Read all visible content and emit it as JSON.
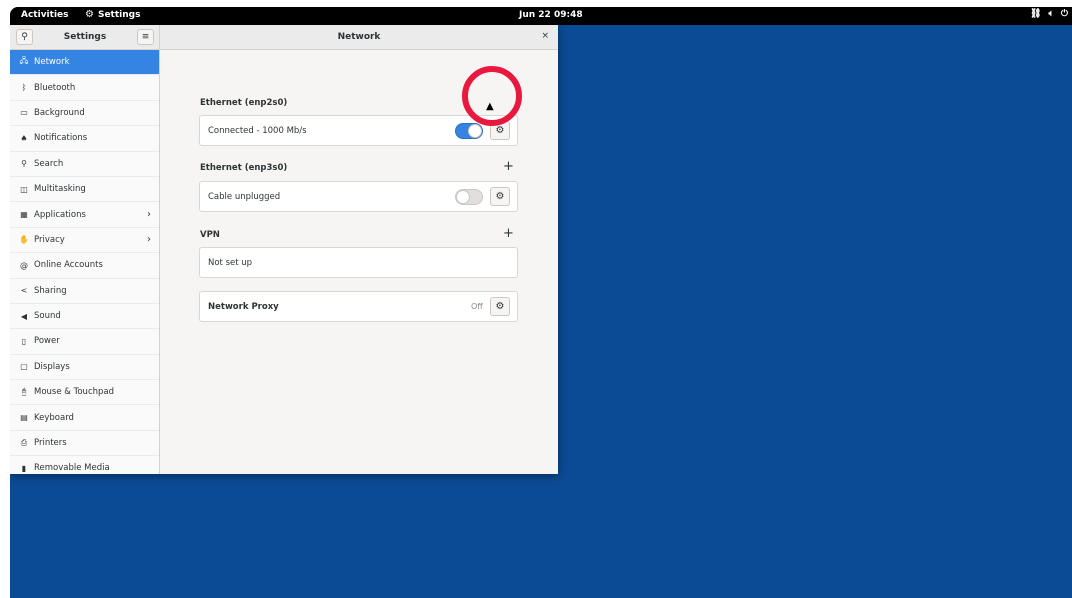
{
  "topbar": {
    "activities": "Activities",
    "app_name": "Settings",
    "clock": "Jun 22  09:48",
    "tray_icons": [
      "network-icon",
      "volume-icon",
      "power-icon"
    ]
  },
  "window": {
    "sidebar_title": "Settings",
    "main_title": "Network",
    "close_glyph": "×"
  },
  "sidebar": {
    "items": [
      {
        "label": "Network",
        "icon": "network-icon",
        "active": true
      },
      {
        "label": "Bluetooth",
        "icon": "bluetooth-icon"
      },
      {
        "label": "Background",
        "icon": "background-icon"
      },
      {
        "label": "Notifications",
        "icon": "bell-icon"
      },
      {
        "label": "Search",
        "icon": "search-icon"
      },
      {
        "label": "Multitasking",
        "icon": "multitasking-icon"
      },
      {
        "label": "Applications",
        "icon": "applications-icon",
        "chevron": true
      },
      {
        "label": "Privacy",
        "icon": "privacy-icon",
        "chevron": true
      },
      {
        "label": "Online Accounts",
        "icon": "at-icon"
      },
      {
        "label": "Sharing",
        "icon": "share-icon"
      },
      {
        "label": "Sound",
        "icon": "speaker-icon"
      },
      {
        "label": "Power",
        "icon": "battery-icon"
      },
      {
        "label": "Displays",
        "icon": "display-icon"
      },
      {
        "label": "Mouse & Touchpad",
        "icon": "mouse-icon"
      },
      {
        "label": "Keyboard",
        "icon": "keyboard-icon"
      },
      {
        "label": "Printers",
        "icon": "printer-icon"
      },
      {
        "label": "Removable Media",
        "icon": "usb-icon"
      }
    ]
  },
  "network": {
    "ethernet1": {
      "label": "Ethernet (enp2s0)",
      "status": "Connected - 1000 Mb/s",
      "enabled": true
    },
    "ethernet2": {
      "label": "Ethernet (enp3s0)",
      "status": "Cable unplugged",
      "enabled": false,
      "add": "+"
    },
    "vpn": {
      "label": "VPN",
      "status": "Not set up",
      "add": "+"
    },
    "proxy": {
      "label": "Network Proxy",
      "state": "Off"
    }
  },
  "colors": {
    "accent": "#3584e4",
    "desktop": "#0b4a94",
    "highlight": "#e8183f"
  }
}
